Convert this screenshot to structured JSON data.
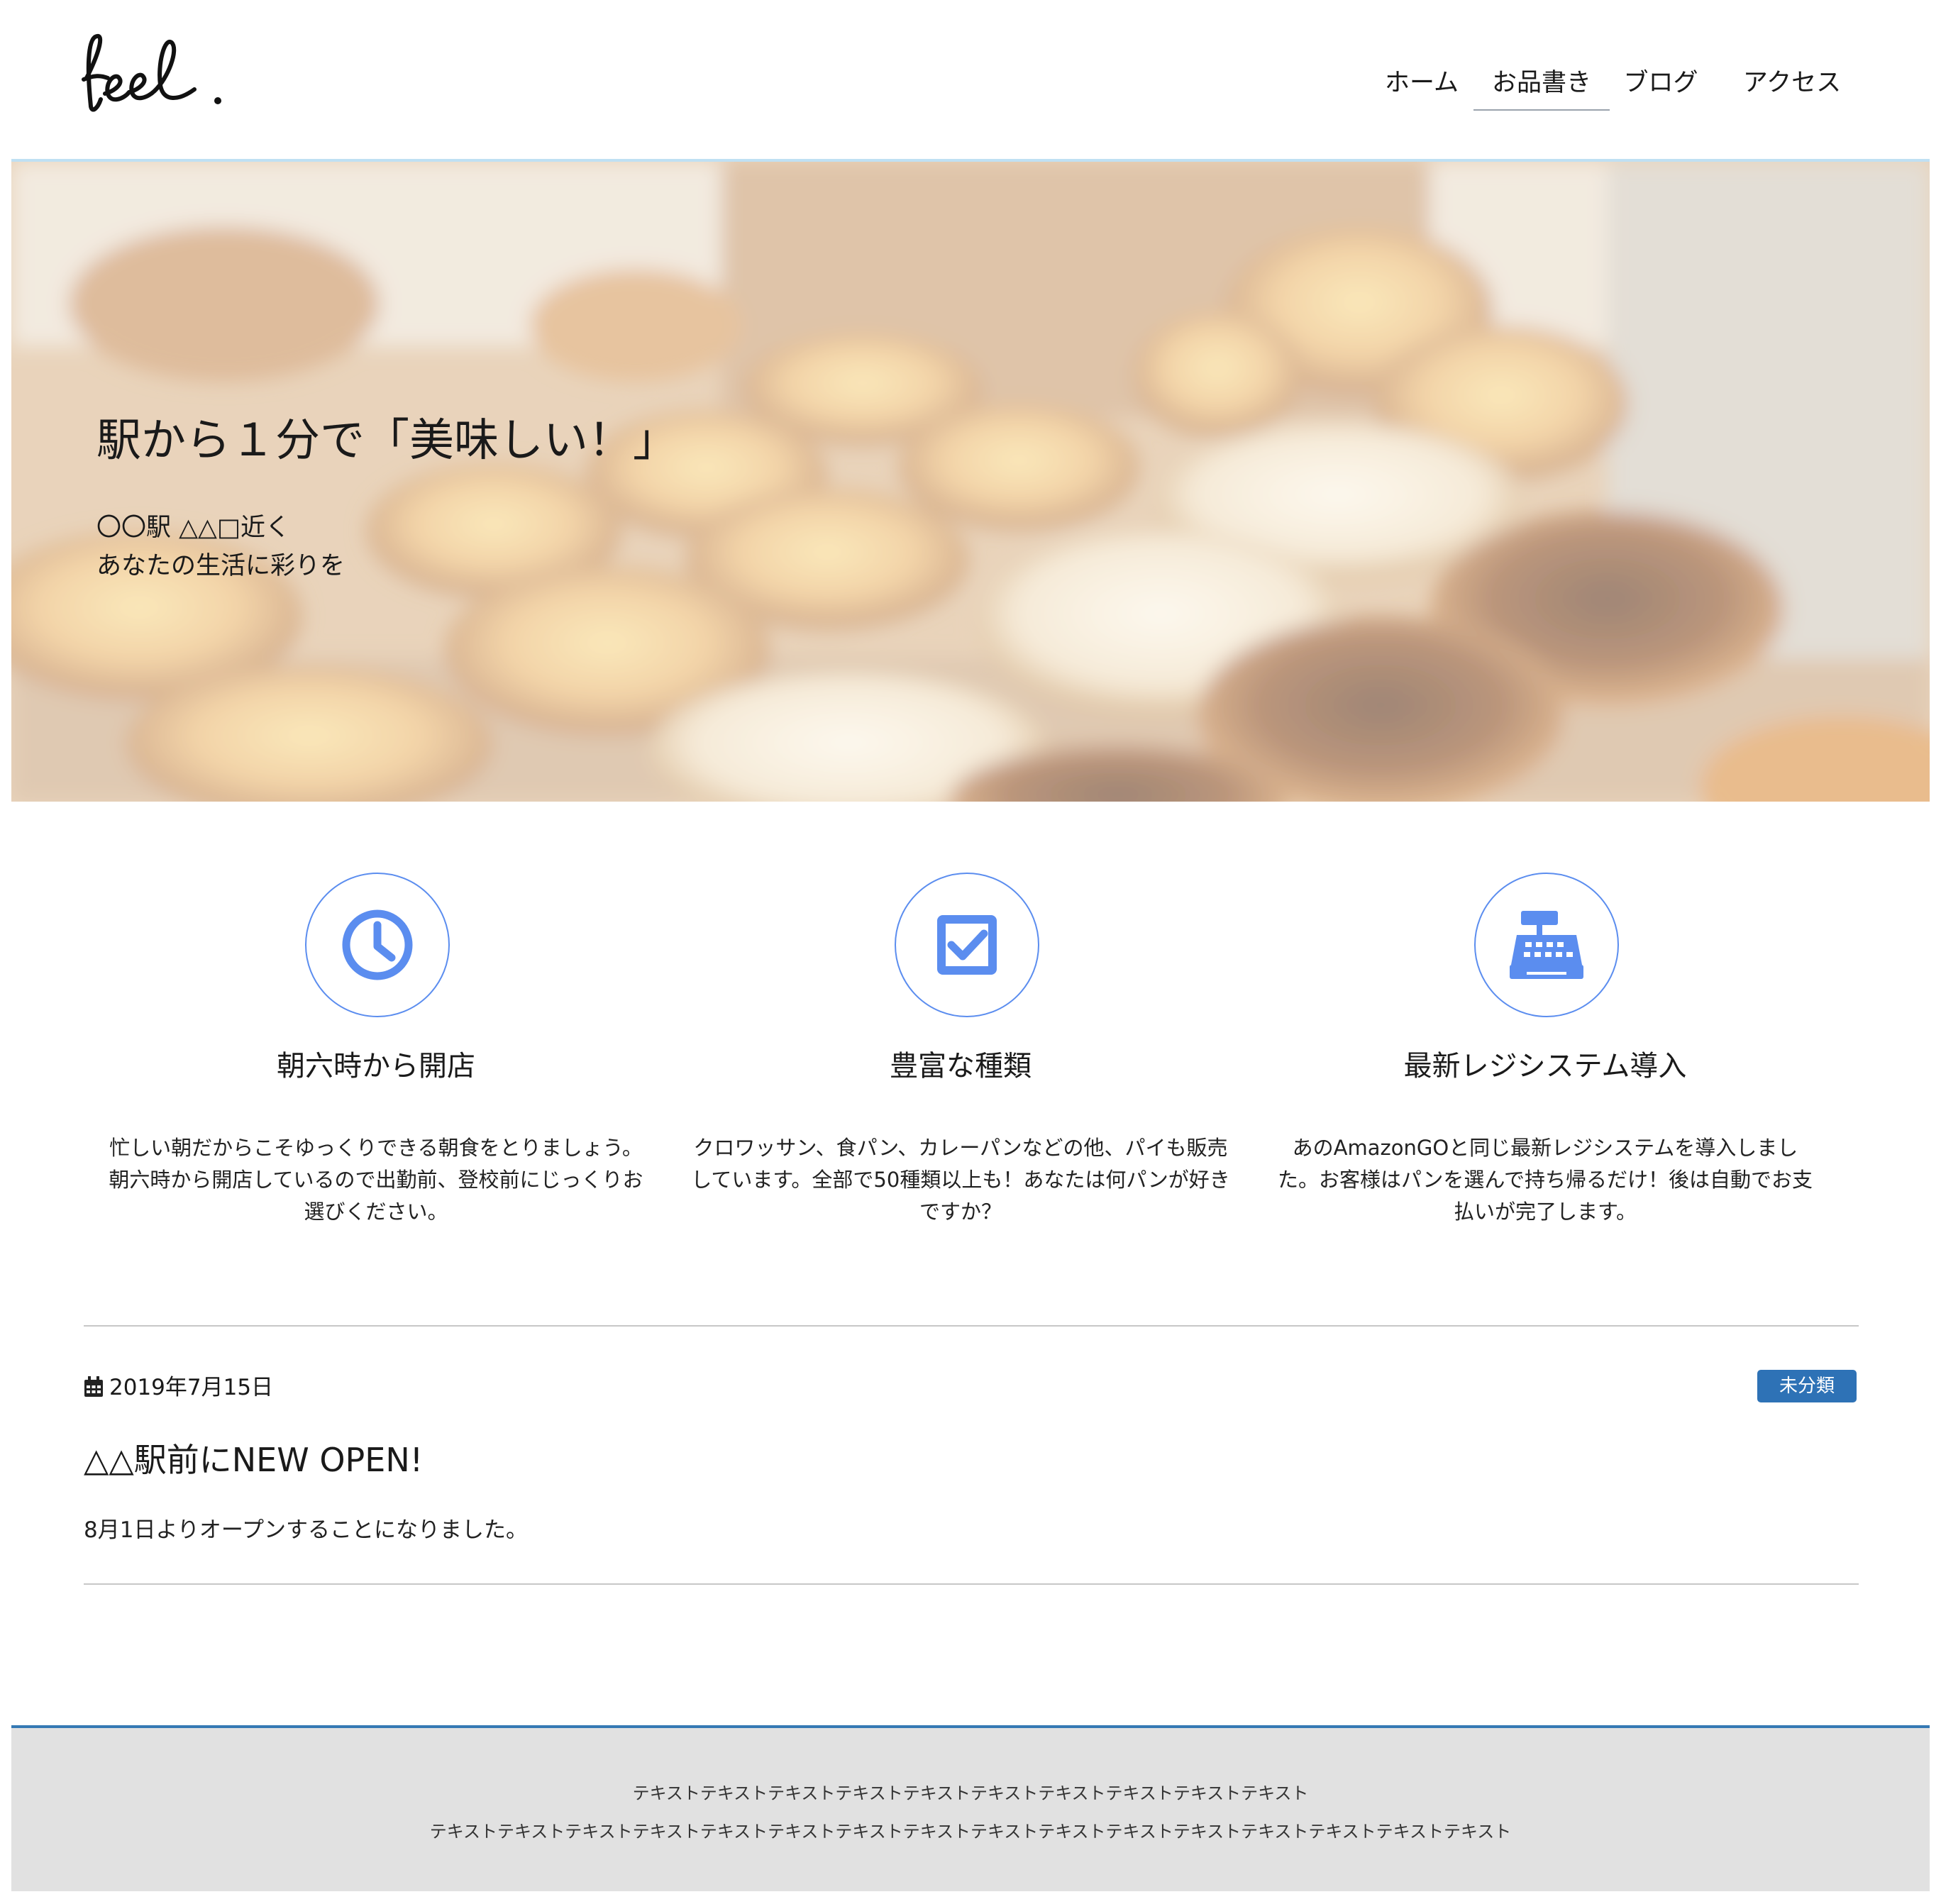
{
  "header": {
    "logo_text": "feel.",
    "nav": [
      {
        "label": "ホーム",
        "active": false
      },
      {
        "label": "お品書き",
        "active": true
      },
      {
        "label": "ブログ",
        "active": false
      },
      {
        "label": "アクセス",
        "active": false
      }
    ]
  },
  "hero": {
    "title": "駅から１分で「美味しい！」",
    "sub_line1": "〇〇駅 △△□近く",
    "sub_line2": "あなたの生活に彩りを"
  },
  "features": [
    {
      "icon": "clock-icon",
      "title": "朝六時から開店",
      "text": "忙しい朝だからこそゆっくりできる朝食をとりましょう。朝六時から開店しているので出勤前、登校前にじっくりお選びください。"
    },
    {
      "icon": "checkbox-icon",
      "title": "豊富な種類",
      "text": "クロワッサン、食パン、カレーパンなどの他、パイも販売しています。全部で50種類以上も！あなたは何パンが好きですか？"
    },
    {
      "icon": "cash-register-icon",
      "title": "最新レジシステム導入",
      "text": "あのAmazonGOと同じ最新レジシステムを導入しました。お客様はパンを選んで持ち帰るだけ！後は自動でお支払いが完了します。"
    }
  ],
  "post": {
    "date": "2019年7月15日",
    "category": "未分類",
    "title": "△△駅前にNEW OPEN!",
    "body": "8月1日よりオープンすることになりました。"
  },
  "footer": {
    "line1": "テキストテキストテキストテキストテキストテキストテキストテキストテキストテキスト",
    "line2": "テキストテキストテキストテキストテキストテキストテキストテキストテキストテキストテキストテキストテキストテキストテキストテキスト"
  },
  "colors": {
    "accent_blue": "#5b8def",
    "badge_blue": "#2e72b6",
    "footer_bg": "#e1e1e1",
    "footer_border": "#3579b4",
    "header_border": "#bfe0f3"
  }
}
